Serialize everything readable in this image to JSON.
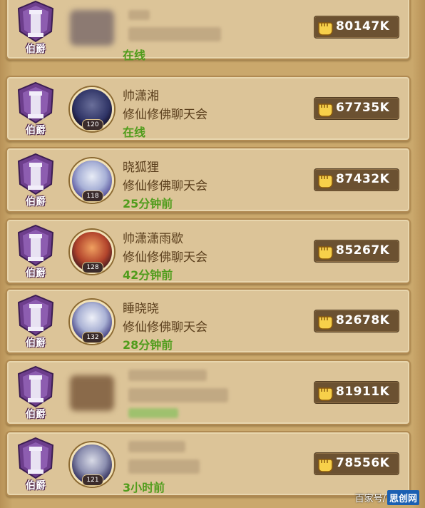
{
  "rows": [
    {
      "rank": "伯爵",
      "name": "",
      "guild": "",
      "status": "在线",
      "power": "80147K",
      "level": "",
      "blurred": true
    },
    {
      "rank": "伯爵",
      "name": "帅潇湘",
      "guild": "修仙修佛聊天会",
      "status": "在线",
      "power": "67735K",
      "level": "120",
      "blurred": false
    },
    {
      "rank": "伯爵",
      "name": "晓狐狸",
      "guild": "修仙修佛聊天会",
      "status": "25分钟前",
      "power": "87432K",
      "level": "118",
      "blurred": false
    },
    {
      "rank": "伯爵",
      "name": "帅潇潇雨歇",
      "guild": "修仙修佛聊天会",
      "status": "42分钟前",
      "power": "85267K",
      "level": "128",
      "blurred": false
    },
    {
      "rank": "伯爵",
      "name": "睡晓晓",
      "guild": "修仙修佛聊天会",
      "status": "28分钟前",
      "power": "82678K",
      "level": "132",
      "blurred": false
    },
    {
      "rank": "伯爵",
      "name": "",
      "guild": "",
      "status": "",
      "power": "81911K",
      "level": "",
      "blurred": true
    },
    {
      "rank": "伯爵",
      "name": "",
      "guild": "",
      "status": "3小时前",
      "power": "78556K",
      "level": "121",
      "blurred": true
    }
  ],
  "watermark": {
    "left": "百家号/",
    "brand": "思创网"
  },
  "colors": {
    "status_green": "#4f9c1b",
    "power_bg": "#6b5131",
    "row_bg": "#dcc498"
  }
}
